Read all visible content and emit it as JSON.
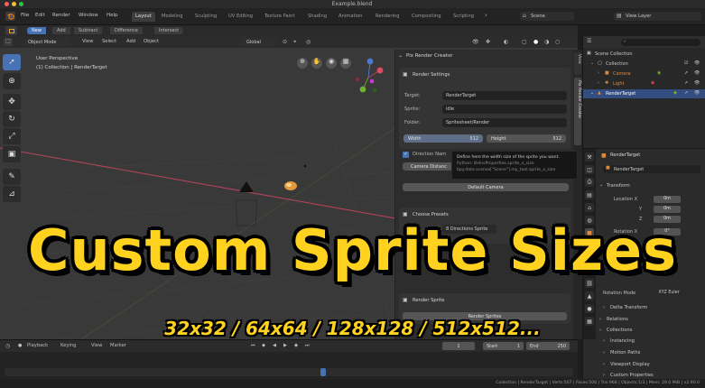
{
  "window": {
    "title": "Example.blend",
    "traffic_lights": [
      "#ff5f57",
      "#febc2e",
      "#28c840"
    ]
  },
  "menubar": {
    "items": [
      "File",
      "Edit",
      "Render",
      "Window",
      "Help"
    ],
    "workspaces": [
      "Layout",
      "Modeling",
      "Sculpting",
      "UV Editing",
      "Texture Paint",
      "Shading",
      "Animation",
      "Rendering",
      "Compositing",
      "Scripting"
    ],
    "active_workspace": "Layout",
    "scene_label": "Scene",
    "view_layer_label": "View Layer"
  },
  "tool_settings": {
    "modes": [
      "New",
      "Add",
      "Subtract",
      "Difference",
      "Intersect"
    ],
    "active_mode": "New"
  },
  "viewport": {
    "mode": "Object Mode",
    "menus": [
      "View",
      "Select",
      "Add",
      "Object"
    ],
    "transform": "Global",
    "overlay_line1": "User Perspective",
    "overlay_line2": "(1) Collection | RenderTarget",
    "grid_color": "#3f3f3f",
    "x_axis_color": "#b4445a",
    "y_axis_color": "#6f9a2a"
  },
  "npanel": {
    "header": "Pix Render Creator",
    "tab_label": "Pix Render Creator",
    "tab_view": "View",
    "render_settings": {
      "title": "Render Settings",
      "target_label": "Target:",
      "target_value": "RenderTarget",
      "sprite_label": "Sprite:",
      "sprite_value": "idle",
      "folder_label": "Folder:",
      "folder_value": "Spritesheet/Render",
      "width_label": "Width",
      "width_value": "512",
      "height_label": "Height",
      "height_value": "512"
    },
    "direction_label": "Direction Nam",
    "camera_btn": "Camera Distanc",
    "default_camera": "Default Camera",
    "choose_presets": "Choose Presets",
    "preset_label": "Set:",
    "preset_value": "8 Directions Sprite",
    "render_sprite": "Render Sprite",
    "render_btn": "Render Sprites"
  },
  "tooltip": {
    "line1": "Define here the width size of the sprite you want.",
    "line2": "Python: BeInsProperties.sprite_x_size",
    "line3": "bpy.data.scenes[\"Scene\"].my_tool.sprite_x_size"
  },
  "outliner": {
    "title": "Scene Collection",
    "rows": [
      {
        "label": "Collection",
        "icon": "collection-icon",
        "color": "#e0e0e0"
      },
      {
        "label": "Camera",
        "icon": "camera-icon",
        "color": "#e08b3a"
      },
      {
        "label": "Light",
        "icon": "light-icon",
        "color": "#e08b3a"
      },
      {
        "label": "RenderTarget",
        "icon": "object-icon",
        "color": "#e08b3a"
      }
    ],
    "selected_index": 3
  },
  "properties": {
    "object_name": "RenderTarget",
    "object_field": "RenderTarget",
    "transform_title": "Transform",
    "location_label": "Location X",
    "rows": [
      {
        "label": "Location X",
        "value": "0m"
      },
      {
        "label": "Y",
        "value": "0m"
      },
      {
        "label": "Z",
        "value": "0m"
      },
      {
        "label": "Rotation X",
        "value": "0°"
      }
    ],
    "rotation_mode_label": "Rotation Mode",
    "rotation_mode_value": "XYZ Euler",
    "subpanels": [
      "Delta Transform",
      "Relations",
      "Collections",
      "Instancing",
      "Motion Paths",
      "Viewport Display",
      "Custom Properties"
    ]
  },
  "timeline": {
    "menus": [
      "Playback",
      "Keying",
      "View",
      "Marker"
    ],
    "current_frame": "1",
    "start_label": "Start",
    "start_value": "1",
    "end_label": "End",
    "end_value": "250"
  },
  "statusbar": {
    "text": "Collection | RenderTarget | Verts:507 | Faces:506 | Tris:968 | Objects:1/3 | Mem: 29.0 MiB | v2.90.0"
  },
  "overlay": {
    "title": "Custom Sprite Sizes",
    "subtitle": "32x32 / 64x64 / 128x128 / 512x512...",
    "color": "#ffd21f"
  }
}
